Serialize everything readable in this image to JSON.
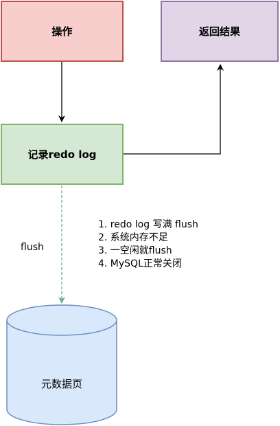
{
  "nodes": {
    "operation": "操作",
    "result": "返回结果",
    "redo_log": "记录redo log",
    "data_page": "元数据页"
  },
  "edges": {
    "flush_label": "flush"
  },
  "flush_conditions": [
    "1. redo log 写满 flush",
    "2. 系统内存不足",
    "3. 一空闲就flush",
    "4. MySQL正常关闭"
  ],
  "colors": {
    "operation_fill": "#f8cecc",
    "operation_stroke": "#b85450",
    "result_fill": "#e1d5e7",
    "result_stroke": "#9673a6",
    "redo_fill": "#d5e8d4",
    "redo_stroke": "#82b366",
    "db_fill": "#dae8fc",
    "db_stroke": "#6c8ebf",
    "flush_arrow": "#67ab9f"
  }
}
